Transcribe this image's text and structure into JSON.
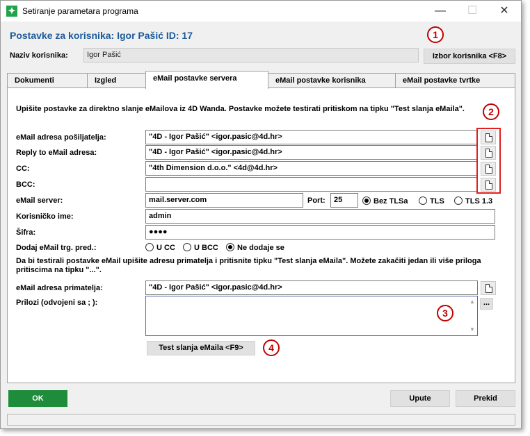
{
  "window": {
    "title": "Setiranje parametara programa",
    "minimize_glyph": "—",
    "maximize_glyph": "☐",
    "close_glyph": "✕"
  },
  "header": {
    "title": "Postavke za korisnika: Igor Pašić ID: 17",
    "user_label": "Naziv korisnika:",
    "user_value": "Igor Pašić",
    "select_user_button": "Izbor korisnika <F8>"
  },
  "tabs": [
    {
      "label": "Dokumenti"
    },
    {
      "label": "Izgled"
    },
    {
      "label": "eMail postavke servera"
    },
    {
      "label": "eMail postavke korisnika"
    },
    {
      "label": "eMail postavke tvrtke"
    }
  ],
  "active_tab": 2,
  "panel": {
    "intro": "Upišite postavke za direktno slanje eMailova iz 4D Wanda. Postavke možete testirati pritiskom na tipku \"Test slanja eMaila\".",
    "sender_label": "eMail adresa pošiljatelja:",
    "sender_value": "\"4D - Igor Pašić\" <igor.pasic@4d.hr>",
    "replyto_label": "Reply to eMail adresa:",
    "replyto_value": "\"4D - Igor Pašić\" <igor.pasic@4d.hr>",
    "cc_label": "CC:",
    "cc_value": "\"4th Dimension d.o.o.\" <4d@4d.hr>",
    "bcc_label": "BCC:",
    "bcc_value": "",
    "server_label": "eMail server:",
    "server_value": "mail.server.com",
    "port_label": "Port:",
    "port_value": "25",
    "security_options": [
      "Bez TLSa",
      "TLS",
      "TLS 1.3"
    ],
    "security_selected": "Bez TLSa",
    "username_label": "Korisničko ime:",
    "username_value": "admin",
    "password_label": "Šifra:",
    "password_value": "●●●●",
    "addcompany_label": "Dodaj eMail trg. pred.:",
    "addcompany_options": [
      "U CC",
      "U BCC",
      "Ne dodaje se"
    ],
    "addcompany_selected": "Ne dodaje se",
    "test_intro": "Da bi testirali postavke eMail upišite adresu primatelja i pritisnite tipku \"Test slanja eMaila\". Možete zakačiti jedan ili više priloga pritiscima na tipku \"...\".",
    "recipient_label": "eMail adresa primatelja:",
    "recipient_value": "\"4D - Igor Pašić\" <igor.pasic@4d.hr>",
    "attachments_label": "Prilozi (odvojeni sa ; ):",
    "attachments_value": "",
    "attach_button": "...",
    "test_button": "Test slanja eMaila <F9>"
  },
  "badges": [
    "1",
    "2",
    "3",
    "4"
  ],
  "footer": {
    "ok_button": "OK",
    "help_button": "Upute",
    "cancel_button": "Prekid"
  },
  "colors": {
    "header_blue": "#1c5a9a",
    "ok_green": "#1e8c3a",
    "badge_red": "#c00000"
  },
  "icons": [
    "app-icon",
    "document-icon"
  ]
}
